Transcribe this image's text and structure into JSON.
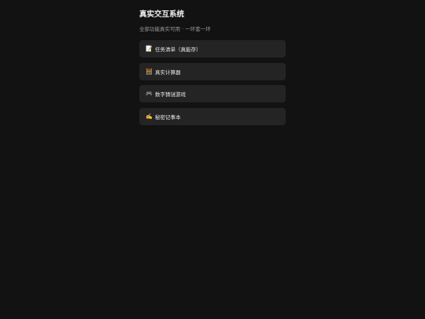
{
  "header": {
    "title": "真实交互系统",
    "subtitle": "全部功能真实可用 · 一环套一环"
  },
  "menu": {
    "items": [
      {
        "icon": "📝",
        "icon_name": "memo-icon",
        "label": "任务清单（真能存）"
      },
      {
        "icon": "🧮",
        "icon_name": "abacus-icon",
        "label": "真实计算器"
      },
      {
        "icon": "🎮",
        "icon_name": "gamepad-icon",
        "label": "数字猜谜游戏"
      },
      {
        "icon": "✍️",
        "icon_name": "writing-hand-icon",
        "label": "秘密记事本"
      }
    ]
  }
}
